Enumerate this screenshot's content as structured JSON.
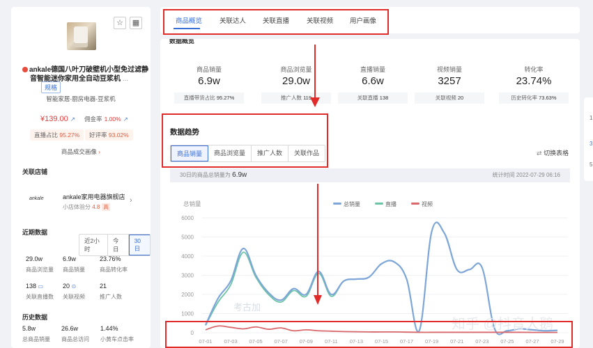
{
  "product": {
    "title_line1": "ankale德国八叶刀破壁机小型免过滤静",
    "title_line2": "音智能迷你家用全自动豆浆机",
    "more": "...",
    "tag": "规格",
    "category": "智能家居-厨房电器-豆浆机",
    "price": "¥139.00",
    "commission_label": "佣金率",
    "commission": "1.00%",
    "live_share_label": "直播占比",
    "live_share": "95.27%",
    "good_rate_label": "好评率",
    "good_rate": "93.02%",
    "portrait_link": "商品成交画像",
    "star_icon": "star-icon",
    "qr_icon": "qrcode-icon"
  },
  "shop": {
    "section": "关联店铺",
    "logo": "ankale",
    "name": "ankale家用电器旗舰店",
    "score_label": "小店体验分",
    "score": "4.8",
    "level": "高"
  },
  "recent": {
    "section": "近期数据",
    "ranges": [
      "近2小时",
      "今日",
      "30日"
    ],
    "active_range": "30日",
    "stats": [
      {
        "value": "29.0w",
        "label": "商品浏览量"
      },
      {
        "value": "6.9w",
        "label": "商品销量"
      },
      {
        "value": "23.76%",
        "label": "商品转化率"
      },
      {
        "value": "138",
        "label": "关联直播数"
      },
      {
        "value": "20",
        "label": "关联视频"
      },
      {
        "value": "21",
        "label": "推广人数"
      }
    ]
  },
  "history": {
    "section": "历史数据",
    "stats": [
      {
        "value": "5.8w",
        "label": "总商品销量"
      },
      {
        "value": "26.6w",
        "label": "商品总访问"
      },
      {
        "value": "1.44%",
        "label": "小黄车点击率"
      }
    ]
  },
  "tabs": [
    "商品概览",
    "关联达人",
    "关联直播",
    "关联视频",
    "用户画像"
  ],
  "active_tab": "商品概览",
  "overview": {
    "section_title": "数据概览",
    "kpis": [
      {
        "name": "商品销量",
        "value": "6.9w",
        "sub_label": "直播带货占比",
        "sub_value": "95.27%"
      },
      {
        "name": "商品浏览量",
        "value": "29.0w",
        "sub_label": "推广人数",
        "sub_value": "119"
      },
      {
        "name": "直播销量",
        "value": "6.6w",
        "sub_label": "关联直播",
        "sub_value": "138"
      },
      {
        "name": "视频销量",
        "value": "3257",
        "sub_label": "关联视频",
        "sub_value": "20"
      },
      {
        "name": "转化率",
        "value": "23.74%",
        "sub_label": "历史转化率",
        "sub_value": "73.63%"
      }
    ]
  },
  "trend": {
    "title": "数据趋势",
    "subtabs": [
      "商品销量",
      "商品浏览量",
      "推广人数",
      "关联作品"
    ],
    "active_subtab": "商品销量",
    "switch_label": "切换表格",
    "info_prefix": "30日的商品总销量为",
    "info_value": "6.9w",
    "stat_time": "统计时间 2022-07-29 06:16"
  },
  "watermarks": {
    "left": "考古加",
    "right": "知乎 @抖音大鹅"
  },
  "right_edge": [
    "1",
    "3",
    "5"
  ],
  "colors": {
    "accent": "#3a6fd8",
    "highlight_box": "#e12a2a",
    "total": "#7ea6d8",
    "live": "#6cc4a6",
    "video": "#d9666a"
  },
  "chart_data": {
    "type": "line",
    "ylabel": "总销量",
    "ylim": [
      0,
      6000
    ],
    "yticks": [
      0,
      1000,
      2000,
      3000,
      4000,
      5000,
      6000
    ],
    "x": [
      "07-01",
      "07-02",
      "07-03",
      "07-04",
      "07-05",
      "07-06",
      "07-07",
      "07-08",
      "07-09",
      "07-10",
      "07-11",
      "07-12",
      "07-13",
      "07-14",
      "07-15",
      "07-16",
      "07-17",
      "07-18",
      "07-19",
      "07-20",
      "07-21",
      "07-22",
      "07-23",
      "07-24",
      "07-25",
      "07-26",
      "07-27",
      "07-28",
      "07-29"
    ],
    "xtick_labels": [
      "07-01",
      "07-03",
      "07-05",
      "07-07",
      "07-09",
      "07-11",
      "07-13",
      "07-15",
      "07-17",
      "07-19",
      "07-21",
      "07-23",
      "07-25",
      "07-27",
      "07-29"
    ],
    "legend": "top-center",
    "series": [
      {
        "name": "总销量",
        "values": [
          400,
          1800,
          2700,
          4400,
          3000,
          2100,
          1700,
          2300,
          2000,
          3200,
          2000,
          2700,
          2800,
          2900,
          3600,
          3700,
          2800,
          100,
          5300,
          5200,
          3300,
          3300,
          3400,
          200,
          100,
          200,
          150,
          100,
          120
        ]
      },
      {
        "name": "直播",
        "values": [
          380,
          1600,
          2500,
          4200,
          2900,
          2000,
          1600,
          2200,
          1900,
          3100,
          1900,
          2700,
          2800,
          2900,
          3600,
          3700,
          2800,
          100,
          5300,
          5200,
          3300,
          3300,
          3400,
          200,
          100,
          200,
          150,
          100,
          120
        ]
      },
      {
        "name": "视频",
        "values": [
          150,
          350,
          280,
          200,
          300,
          180,
          250,
          100,
          150,
          100,
          80,
          60,
          50,
          40,
          40,
          40,
          30,
          20,
          20,
          20,
          20,
          20,
          20,
          20,
          20,
          20,
          15,
          15,
          15
        ]
      }
    ]
  }
}
